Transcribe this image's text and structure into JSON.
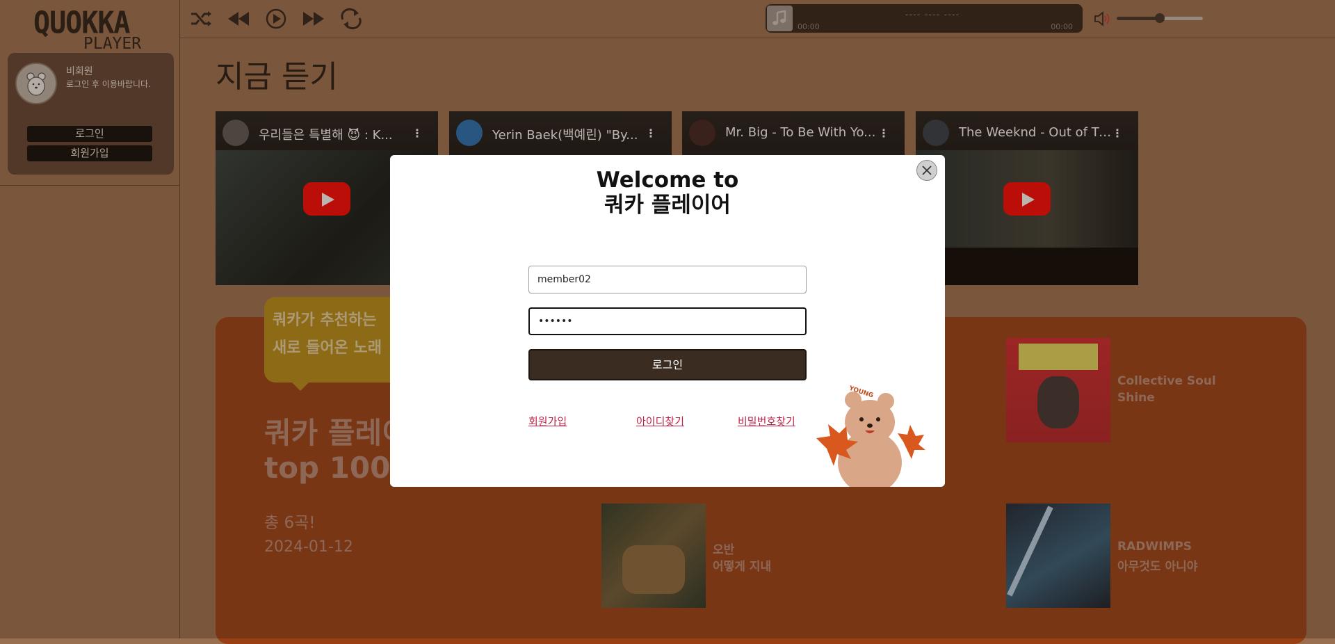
{
  "app": {
    "logo_line1": "QUOKKA",
    "logo_line2": "PLAYER"
  },
  "sidebar": {
    "user_name": "비회원",
    "user_message": "로그인 후 이용바랍니다.",
    "login_label": "로그인",
    "signup_label": "회원가입"
  },
  "player": {
    "title": "---- ---- ----",
    "time_current": "00:00",
    "time_total": "00:00",
    "volume_percent": 50,
    "icons": [
      "shuffle-icon",
      "previous-icon",
      "play-icon",
      "next-icon",
      "repeat-icon",
      "volume-icon",
      "music-note-icon"
    ]
  },
  "main": {
    "page_title": "지금 듣기",
    "videos": [
      {
        "title": "우리들은 특별해 😈 : K..."
      },
      {
        "title": "Yerin Baek(백예린) \"By..."
      },
      {
        "title": "Mr. Big - To Be With Yo..."
      },
      {
        "title": "The Weeknd - Out of Ti..."
      }
    ],
    "recommend_bubble": [
      "쿼카가 추천하는",
      "새로 들어온 노래"
    ],
    "chart_title_line1": "쿼카 플레이",
    "chart_title_line2": "top 100",
    "total_count": "총 6곡!",
    "date": "2024-01-12",
    "songs": [
      {
        "artist": "Collective Soul",
        "title": "Shine"
      },
      {
        "artist": "오반",
        "title": "어떻게 지내"
      },
      {
        "artist": "RADWIMPS",
        "title": "아무것도 아니야"
      }
    ]
  },
  "modal": {
    "title_line1": "Welcome to",
    "title_line2": "쿼카 플레이어",
    "id_value": "member02",
    "password_value": "••••••",
    "login_button": "로그인",
    "link_signup": "회원가입",
    "link_find_id": "아이디찾기",
    "link_find_password": "비밀번호찾기",
    "mascot_text": "YOUNG"
  },
  "colors": {
    "background": "#9a6f4f",
    "panel": "#9a3e13",
    "accent_dark": "#3a2c21",
    "link": "#c12348",
    "bubble": "#b98f14"
  }
}
